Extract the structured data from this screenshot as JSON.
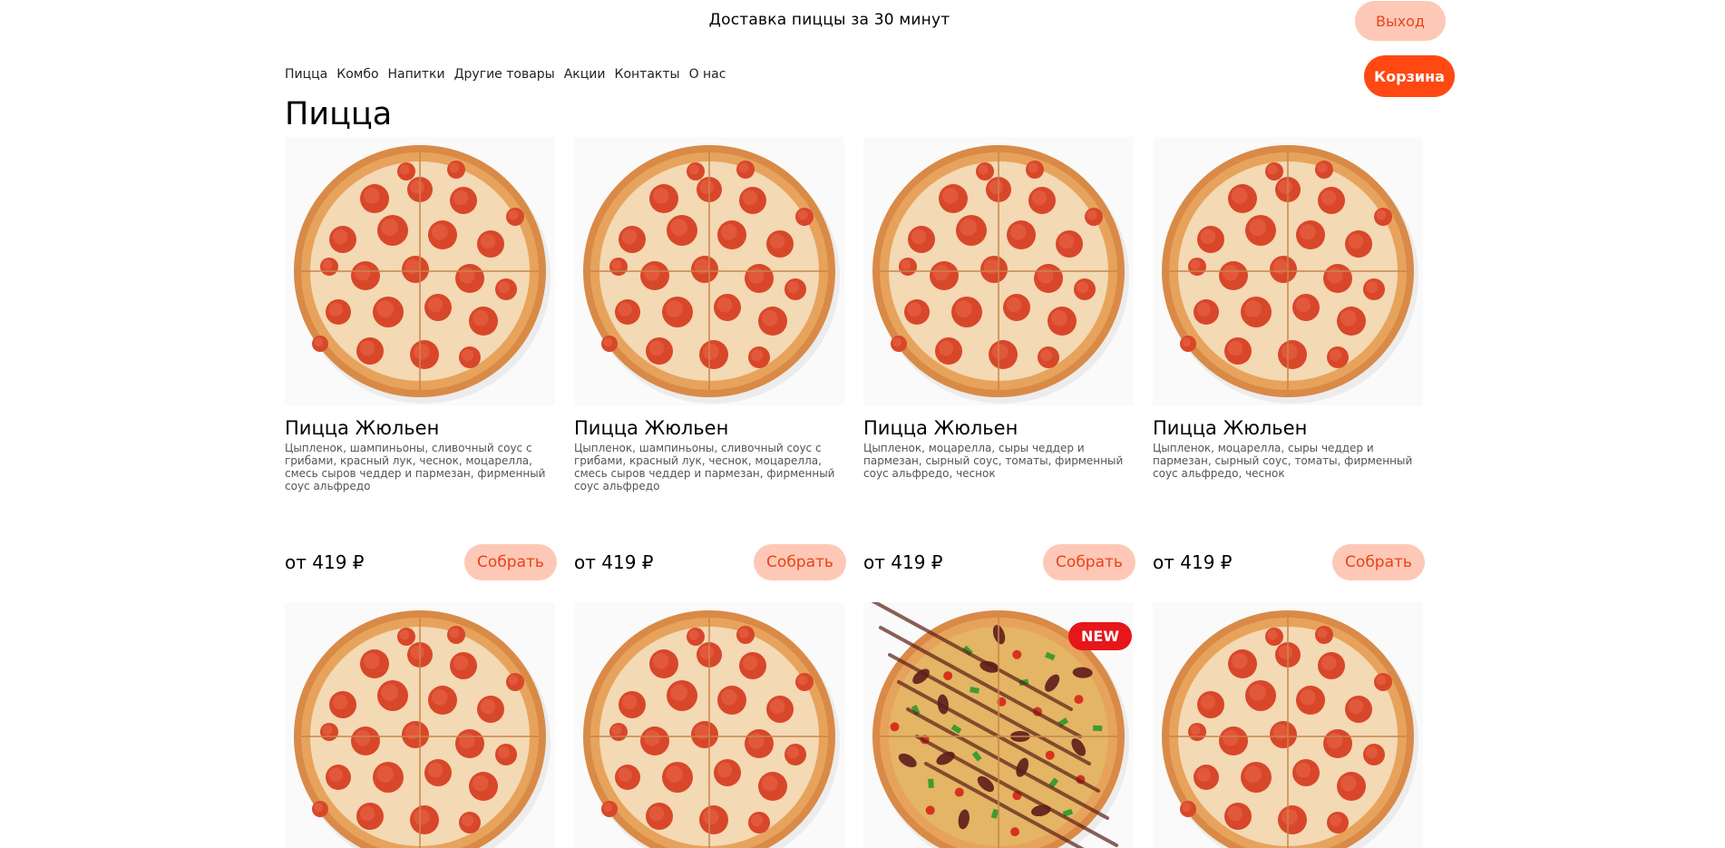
{
  "header": {
    "title": "Доставка пиццы за 30 минут",
    "logout_label": "Выход",
    "cart_label": "Корзина"
  },
  "nav": {
    "items": [
      "Пицца",
      "Комбо",
      "Напитки",
      "Другие товары",
      "Акции",
      "Контакты",
      "О нас"
    ]
  },
  "section": {
    "title": "Пицца"
  },
  "products": [
    {
      "name": "Пицца Жюльен",
      "desc": "Цыпленок, шампиньоны, сливочный соус с грибами, красный лук, чеснок, моцарелла, смесь сыров чеддер и пармезан, фирменный соус альфредо",
      "price": "от 419 ₽",
      "button": "Собрать"
    },
    {
      "name": "Пицца Жюльен",
      "desc": "Цыпленок, шампиньоны, сливочный соус с грибами, красный лук, чеснок, моцарелла, смесь сыров чеддер и пармезан, фирменный соус альфредо",
      "price": "от 419 ₽",
      "button": "Собрать"
    },
    {
      "name": "Пицца Жюльен",
      "desc": "Цыпленок, моцарелла, сыры чеддер и пармезан, сырный соус, томаты, фирменный соус альфредо, чеснок",
      "price": "от 419 ₽",
      "button": "Собрать"
    },
    {
      "name": "Пицца Жюльен",
      "desc": "Цыпленок, моцарелла, сыры чеддер и пармезан, сырный соус, томаты, фирменный соус альфредо, чеснок",
      "price": "от 419 ₽",
      "button": "Собрать"
    },
    {
      "image": "pepperoni-pizza"
    },
    {
      "image": "pepperoni-pizza"
    },
    {
      "image": "meat-pizza",
      "badge": "NEW"
    },
    {
      "image": "pepperoni-pizza"
    }
  ],
  "colors": {
    "accent": "#ff4812",
    "accent_soft": "#fec8b6",
    "accent_text": "#e8431a",
    "badge": "#e6161b"
  }
}
